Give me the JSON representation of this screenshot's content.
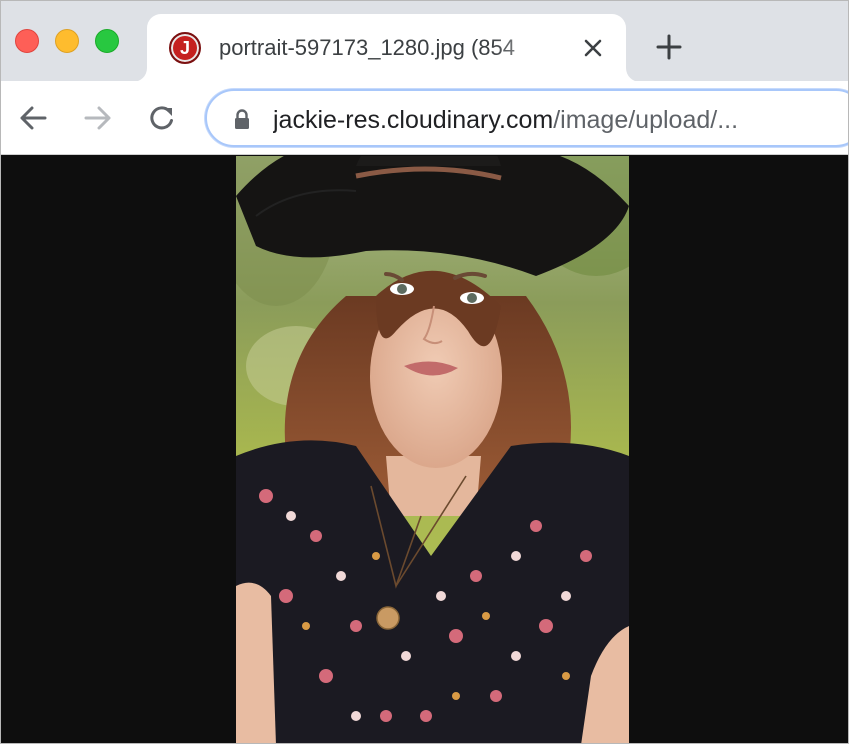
{
  "window": {
    "traffic_lights": [
      {
        "name": "close",
        "color": "#fe5f57"
      },
      {
        "name": "minimize",
        "color": "#febc2e"
      },
      {
        "name": "maximize",
        "color": "#28c840"
      }
    ]
  },
  "tab": {
    "favicon_letter": "J",
    "favicon_color": "#c5201f",
    "title": "portrait-597173_1280.jpg (854",
    "close_icon": "close-icon"
  },
  "toolbar": {
    "back_icon": "back-arrow-icon",
    "forward_icon": "forward-arrow-icon",
    "reload_icon": "reload-icon",
    "new_tab_icon": "plus-icon"
  },
  "address_bar": {
    "lock_icon": "lock-icon",
    "host": "jackie-res.cloudinary.com",
    "path": "/image/upload/..."
  },
  "content": {
    "image_name": "portrait-597173_1280.jpg",
    "background_color": "#0e0e0e"
  }
}
